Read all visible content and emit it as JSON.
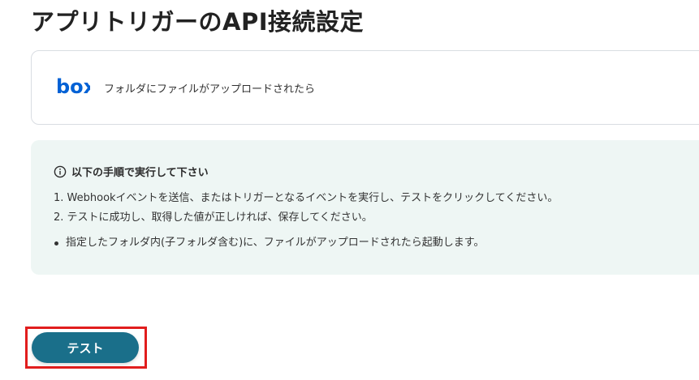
{
  "page": {
    "title": "アプリトリガーのAPI接続設定"
  },
  "app_card": {
    "logo_text": "box",
    "logo_icon": "box-logo",
    "trigger_label": "フォルダにファイルがアップロードされたら"
  },
  "instructions": {
    "icon": "info-icon",
    "heading": "以下の手順で実行して下さい",
    "steps": [
      "1. Webhookイベントを送信、またはトリガーとなるイベントを実行し、テストをクリックしてください。",
      "2. テストに成功し、取得した値が正しければ、保存してください。"
    ],
    "notes": [
      "指定したフォルダ内(子フォルダ含む)に、ファイルがアップロードされたら起動します。"
    ]
  },
  "actions": {
    "test_label": "テスト",
    "highlight_color": "#e11d1d",
    "button_color": "#1a6f8a"
  },
  "colors": {
    "brand_box": "#0061d5",
    "panel_bg": "#eef6f4"
  }
}
